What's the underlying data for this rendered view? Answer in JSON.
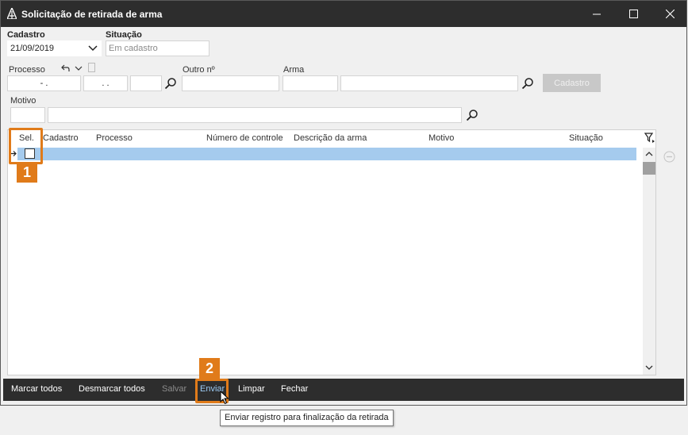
{
  "window": {
    "title": "Solicitação de retirada de arma"
  },
  "form": {
    "cadastro_label": "Cadastro",
    "cadastro_value": "21/09/2019",
    "situacao_label": "Situação",
    "situacao_placeholder": "Em cadastro",
    "processo_label": "Processo",
    "processo_part1": "- .",
    "processo_part2": ". .",
    "outro_label": "Outro nº",
    "arma_label": "Arma",
    "cadastro_button": "Cadastro",
    "motivo_label": "Motivo"
  },
  "grid": {
    "columns": [
      "Sel.",
      "Cadastro",
      "Processo",
      "Número de controle",
      "Descrição da arma",
      "Motivo",
      "Situação"
    ],
    "selected_row_checked": false
  },
  "callouts": {
    "one": "1",
    "two": "2"
  },
  "toolbar": {
    "marcar": "Marcar todos",
    "desmarcar": "Desmarcar todos",
    "salvar": "Salvar",
    "enviar": "Enviar",
    "limpar": "Limpar",
    "fechar": "Fechar"
  },
  "tooltip": "Enviar registro para finalização da retirada",
  "colors": {
    "accent": "#e07b1a",
    "titlebar": "#2d2d2d",
    "selected_row": "#a5cbee"
  }
}
